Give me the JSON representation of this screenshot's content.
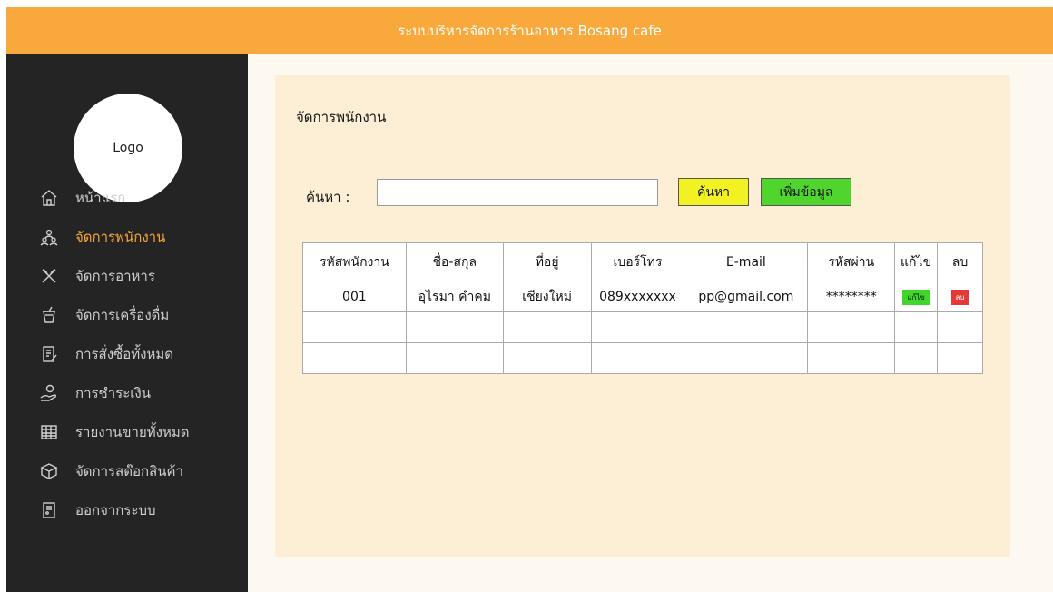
{
  "app": {
    "title": "ระบบบริหารจัดการร้านอาหาร Bosang cafe"
  },
  "sidebar": {
    "logo": "Logo",
    "items": [
      {
        "label": "หน้าแรก",
        "icon": "home-icon",
        "active": false
      },
      {
        "label": "จัดการพนักงาน",
        "icon": "users-icon",
        "active": true
      },
      {
        "label": "จัดการอาหาร",
        "icon": "utensils-icon",
        "active": false
      },
      {
        "label": "จัดการเครื่องดื่ม",
        "icon": "drink-icon",
        "active": false
      },
      {
        "label": "การสั่งซื้อทั้งหมด",
        "icon": "order-icon",
        "active": false
      },
      {
        "label": "การชำระเงิน",
        "icon": "payment-icon",
        "active": false
      },
      {
        "label": "รายงานขายทั้งหมด",
        "icon": "report-icon",
        "active": false
      },
      {
        "label": "จัดการสต๊อกสินค้า",
        "icon": "stock-icon",
        "active": false
      },
      {
        "label": "ออกจากระบบ",
        "icon": "logout-icon",
        "active": false
      }
    ]
  },
  "main": {
    "title": "จัดการพนักงาน",
    "search": {
      "label": "ค้นหา :",
      "value": "",
      "placeholder": ""
    },
    "buttons": {
      "search": "ค้นหา",
      "add": "เพิ่มข้อมูล"
    },
    "table": {
      "headers": [
        "รหัสพนักงาน",
        "ชื่อ-สกุล",
        "ที่อยู่",
        "เบอร์โทร",
        "E-mail",
        "รหัสผ่าน",
        "แก้ไข",
        "ลบ"
      ],
      "rows": [
        [
          "001",
          "อุไรมา คำคม",
          "เชียงใหม่",
          "089xxxxxxx",
          "pp@gmail.com",
          "********"
        ]
      ],
      "edit_label": "แก้ไข",
      "delete_label": "ลบ"
    }
  },
  "colors": {
    "header": "#f9a93c",
    "sidebar": "#242424",
    "active": "#f9a93c",
    "panel": "#fdefd6",
    "search_button": "#f2f222",
    "add_button": "#4fd52c",
    "edit_button": "#3fd82a",
    "delete_button": "#e53935"
  }
}
